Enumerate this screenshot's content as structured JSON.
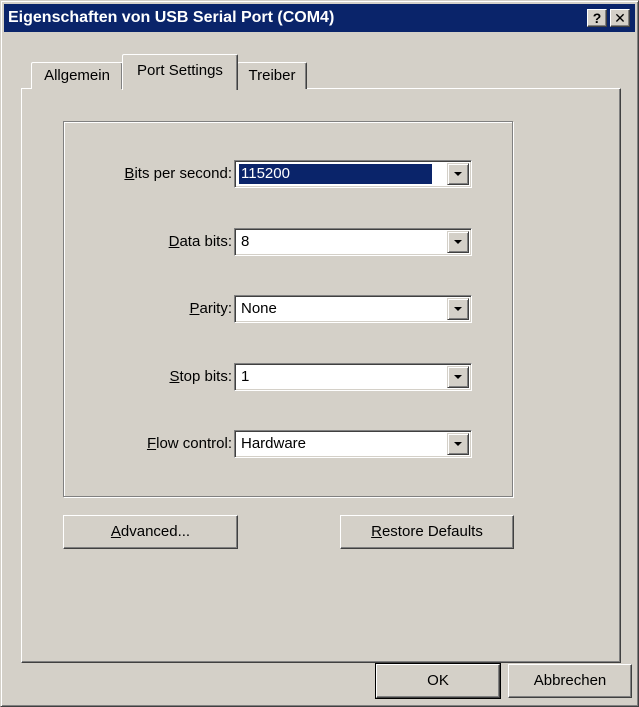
{
  "window": {
    "title": "Eigenschaften von USB Serial Port (COM4)",
    "help_button": "?",
    "close_button": "✕"
  },
  "tabs": [
    {
      "label": "Allgemein",
      "selected": false
    },
    {
      "label": "Port Settings",
      "selected": true
    },
    {
      "label": "Treiber",
      "selected": false
    }
  ],
  "settings": {
    "bits_per_second": {
      "accel": "B",
      "label_rest": "its per second:",
      "value": "115200"
    },
    "data_bits": {
      "accel": "D",
      "label_rest": "ata bits:",
      "value": "8"
    },
    "parity": {
      "accel": "P",
      "label_rest": "arity:",
      "value": "None"
    },
    "stop_bits": {
      "accel": "S",
      "label_rest": "top bits:",
      "value": "1"
    },
    "flow_control": {
      "accel": "F",
      "label_rest": "low control:",
      "value": "Hardware"
    }
  },
  "buttons": {
    "advanced": {
      "accel": "A",
      "rest": "dvanced..."
    },
    "restore": {
      "accel": "R",
      "rest": "estore Defaults"
    },
    "ok": "OK",
    "cancel": "Abbrechen"
  },
  "colors": {
    "face": "#d4d0c8",
    "titlebar": "#0a246a",
    "selection": "#0a246a"
  }
}
